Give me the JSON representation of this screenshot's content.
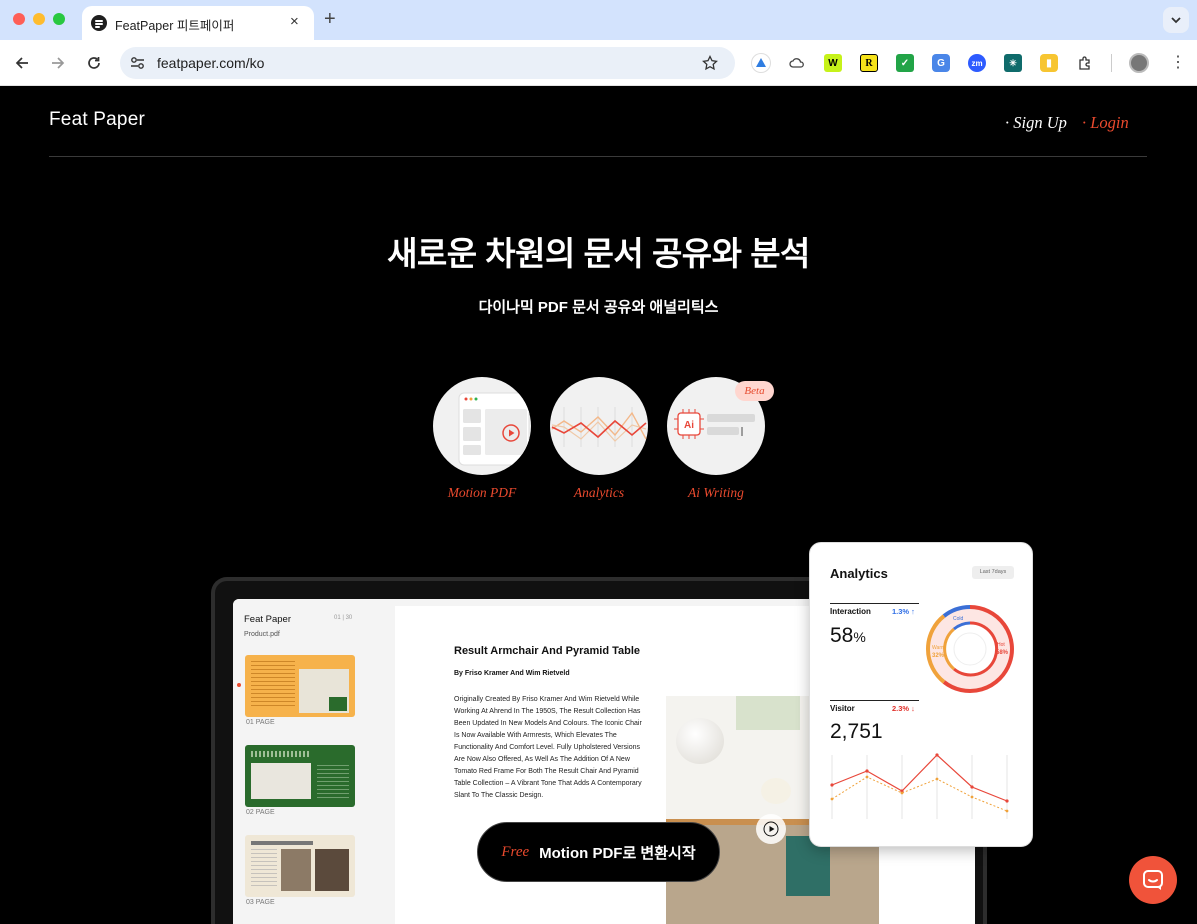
{
  "browser": {
    "tab_title": "FeatPaper 피트페이퍼",
    "tab_close": "×",
    "new_tab": "+",
    "url": "featpaper.com/ko",
    "extensions": [
      "google-drive-extension-icon",
      "cloud-extension-icon",
      "w-extension-icon",
      "r-extension-icon",
      "check-extension-icon",
      "translate-extension-icon",
      "zoom-extension-icon",
      "network-extension-icon",
      "keep-extension-icon",
      "puzzle-icon"
    ]
  },
  "header": {
    "logo": "Feat Paper",
    "signup": "· Sign Up",
    "login": "· Login"
  },
  "hero": {
    "title": "새로운 차원의 문서 공유와 분석",
    "subtitle": "다이나믹 PDF 문서 공유와 애널리틱스"
  },
  "features": [
    {
      "label": "Motion PDF"
    },
    {
      "label": "Analytics"
    },
    {
      "label": "Ai Writing",
      "badge": "Beta",
      "icon_text": "Ai"
    }
  ],
  "viewer": {
    "brand": "Feat Paper",
    "page_count": "01 | 30",
    "file": "Product.pdf",
    "pages": [
      {
        "label": "01  PAGE",
        "color": "#f6b24b"
      },
      {
        "label": "02  PAGE",
        "color": "#2a6b2c"
      },
      {
        "label": "03  PAGE",
        "color": "#efe7d6"
      }
    ],
    "doc_title": "Result Armchair And Pyramid Table",
    "doc_author": "By Friso Kramer And Wim Rietveld",
    "doc_body": "Originally Created By Friso Kramer And Wim Rietveld While Working At Ahrend In The 1950S, The Result Collection Has Been Updated In New Models And Colours. The Iconic Chair Is Now Available With Armrests, Which Elevates The Functionality And Comfort Level. Fully Upholstered Versions Are Now Also Offered, As Well As The Addition Of A New Tomato Red Frame For Both The Result Chair And Pyramid Table Collection – A Vibrant Tone That Adds A Contemporary Slant To The Classic Design."
  },
  "analytics": {
    "title": "Analytics",
    "range": "Last 7days",
    "interaction_label": "Interaction",
    "interaction_delta": "1.3% ↑",
    "interaction_value": "58",
    "interaction_unit": "%",
    "visitor_label": "Visitor",
    "visitor_delta": "2.3% ↓",
    "visitor_value": "2,751",
    "donut": [
      {
        "name": "Hot",
        "value": 58,
        "color": "#e8473a"
      },
      {
        "name": "Warm",
        "value": 32,
        "color": "#f0a23b"
      },
      {
        "name": "Cold",
        "value": 10,
        "color": "#3b6fd6"
      }
    ],
    "donut_labels": {
      "hot": "Hot",
      "hot_pct": "58%",
      "warm": "Warm",
      "warm_pct": "32%",
      "cold": "Cold"
    },
    "colors": {
      "up": "#2f6ee6",
      "down": "#e0302a"
    }
  },
  "cta": {
    "free": "Free",
    "label": "Motion PDF로 변환시작"
  },
  "colors": {
    "accent": "#ea4a2e",
    "background": "#000000"
  }
}
